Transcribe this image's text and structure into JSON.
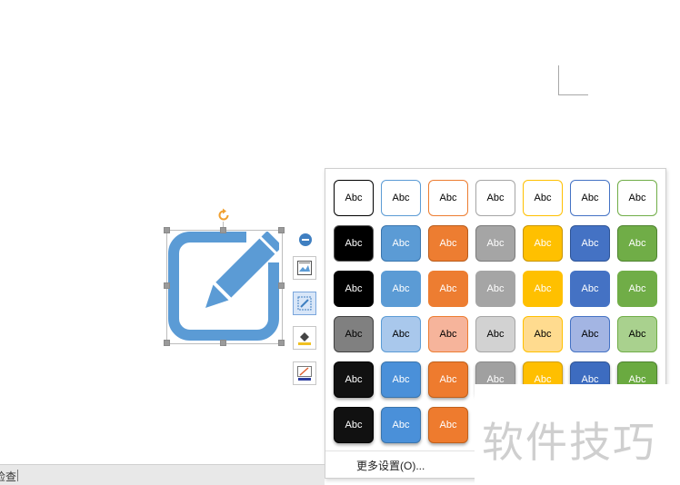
{
  "gallery": {
    "label": "Abc",
    "more_settings": "更多设置(O)...",
    "rows": [
      [
        {
          "bg": "#ffffff",
          "border": "#000000",
          "fg": "#000000"
        },
        {
          "bg": "#ffffff",
          "border": "#5b9bd5",
          "fg": "#000000"
        },
        {
          "bg": "#ffffff",
          "border": "#ed7d31",
          "fg": "#000000"
        },
        {
          "bg": "#ffffff",
          "border": "#a5a5a5",
          "fg": "#000000"
        },
        {
          "bg": "#ffffff",
          "border": "#ffc000",
          "fg": "#000000"
        },
        {
          "bg": "#ffffff",
          "border": "#4472c4",
          "fg": "#000000"
        },
        {
          "bg": "#ffffff",
          "border": "#70ad47",
          "fg": "#000000"
        }
      ],
      [
        {
          "bg": "#000000",
          "border": "#555555",
          "fg": "#ffffff"
        },
        {
          "bg": "#5b9bd5",
          "border": "#3a75ad",
          "fg": "#ffffff"
        },
        {
          "bg": "#ed7d31",
          "border": "#b85c1c",
          "fg": "#ffffff"
        },
        {
          "bg": "#a5a5a5",
          "border": "#7a7a7a",
          "fg": "#ffffff"
        },
        {
          "bg": "#ffc000",
          "border": "#c79400",
          "fg": "#ffffff"
        },
        {
          "bg": "#4472c4",
          "border": "#2f5597",
          "fg": "#ffffff"
        },
        {
          "bg": "#70ad47",
          "border": "#4e8330",
          "fg": "#ffffff"
        }
      ],
      [
        {
          "bg": "#000000",
          "border": "#000000",
          "fg": "#ffffff"
        },
        {
          "bg": "#5b9bd5",
          "border": "#5b9bd5",
          "fg": "#ffffff"
        },
        {
          "bg": "#ed7d31",
          "border": "#ed7d31",
          "fg": "#ffffff"
        },
        {
          "bg": "#a5a5a5",
          "border": "#a5a5a5",
          "fg": "#ffffff"
        },
        {
          "bg": "#ffc000",
          "border": "#ffc000",
          "fg": "#ffffff"
        },
        {
          "bg": "#4472c4",
          "border": "#4472c4",
          "fg": "#ffffff"
        },
        {
          "bg": "#70ad47",
          "border": "#70ad47",
          "fg": "#ffffff"
        }
      ],
      [
        {
          "bg": "#808080",
          "border": "#404040",
          "fg": "#000000"
        },
        {
          "bg": "#a9c8ec",
          "border": "#5b9bd5",
          "fg": "#000000"
        },
        {
          "bg": "#f6b49b",
          "border": "#ed7d31",
          "fg": "#000000"
        },
        {
          "bg": "#d2d2d2",
          "border": "#a5a5a5",
          "fg": "#000000"
        },
        {
          "bg": "#ffdb8f",
          "border": "#ffc000",
          "fg": "#000000"
        },
        {
          "bg": "#a3b5e3",
          "border": "#4472c4",
          "fg": "#000000"
        },
        {
          "bg": "#a9d18e",
          "border": "#70ad47",
          "fg": "#000000"
        }
      ],
      [
        {
          "bg": "#111111",
          "border": "#000000",
          "fg": "#ffffff"
        },
        {
          "bg": "#4a90d9",
          "border": "#3a75ad",
          "fg": "#ffffff"
        },
        {
          "bg": "#ee7b2e",
          "border": "#c0601b",
          "fg": "#ffffff"
        },
        {
          "bg": "#a0a0a0",
          "border": "#8a8a8a",
          "fg": "#ffffff"
        },
        {
          "bg": "#ffbf00",
          "border": "#d39e00",
          "fg": "#ffffff"
        },
        {
          "bg": "#3d6cc0",
          "border": "#2f5597",
          "fg": "#ffffff"
        },
        {
          "bg": "#6aaa40",
          "border": "#4e8330",
          "fg": "#ffffff"
        }
      ],
      [
        {
          "bg": "#111111",
          "border": "#000000",
          "fg": "#ffffff"
        },
        {
          "bg": "#4a90d9",
          "border": "#3a75ad",
          "fg": "#ffffff"
        },
        {
          "bg": "#ee7b2e",
          "border": "#c0601b",
          "fg": "#ffffff"
        }
      ]
    ]
  },
  "watermark": "软件技巧",
  "statusbar": {
    "text": "检查"
  },
  "colors": {
    "icon_blue": "#5b9bd5",
    "rotate_orange": "#f0a030"
  }
}
